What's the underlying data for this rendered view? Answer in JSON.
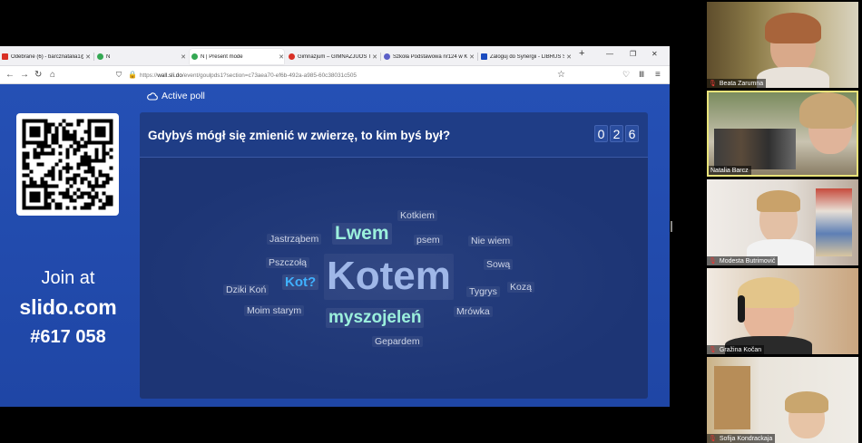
{
  "browser": {
    "tabs": [
      {
        "title": "Odebrane (6) - barcznatalia1@",
        "color": "#d93025"
      },
      {
        "title": "N",
        "color": "#34a853"
      },
      {
        "title": "N | Present mode",
        "color": "#34a853"
      },
      {
        "title": "Gimnazjum – GIMNAZJUOS TIC",
        "color": "#d93025"
      },
      {
        "title": "Szkoła Podstawowa nr124 w Kr",
        "color": "#5b5fc7"
      },
      {
        "title": "Zaloguj do Synergii - LIBRUS S",
        "color": "#1a4bbf"
      }
    ],
    "new_tab_icon": "plus-icon",
    "url": {
      "prefix": "https://",
      "host": "wall.sli.do",
      "path": "/event/goulpds1?section=c73aea70-ef6b-492a-a985-60c38031c505"
    }
  },
  "slido": {
    "status": "Active poll",
    "join": {
      "label": "Join at",
      "site": "slido.com",
      "code": "#617 058"
    },
    "question": "Gdybyś mógł się zmienić w zwierzę, to kim byś był?",
    "responses": [
      "0",
      "2",
      "6"
    ],
    "words": [
      {
        "text": "Kotem",
        "role": "primary"
      },
      {
        "text": "Lwem",
        "role": "secondary"
      },
      {
        "text": "myszojeleń",
        "role": "secondary"
      },
      {
        "text": "Kot?",
        "role": "accent"
      },
      {
        "text": "Kotkiem",
        "role": "minor"
      },
      {
        "text": "Jastrząbem",
        "role": "minor"
      },
      {
        "text": "psem",
        "role": "minor"
      },
      {
        "text": "Nie wiem",
        "role": "minor"
      },
      {
        "text": "Pszczołą",
        "role": "minor"
      },
      {
        "text": "Sową",
        "role": "minor"
      },
      {
        "text": "Dziki Koń",
        "role": "minor"
      },
      {
        "text": "Tygrys",
        "role": "minor"
      },
      {
        "text": "Kozą",
        "role": "minor"
      },
      {
        "text": "Moim starym",
        "role": "minor"
      },
      {
        "text": "Mrówka",
        "role": "minor"
      },
      {
        "text": "Gepardem",
        "role": "minor"
      }
    ],
    "colors": {
      "primary": "#9fb7e8",
      "secondary": "#9bf0dc",
      "accent": "#3fb1ff"
    }
  },
  "participants": [
    {
      "name": "Beata Zarumna",
      "muted": true
    },
    {
      "name": "Natalia Barcz",
      "muted": false,
      "speaking": true
    },
    {
      "name": "Modesta Butrimovič",
      "muted": true
    },
    {
      "name": "Gražina Kočan",
      "muted": true
    },
    {
      "name": "Sofija Kondrackaja",
      "muted": true
    }
  ]
}
